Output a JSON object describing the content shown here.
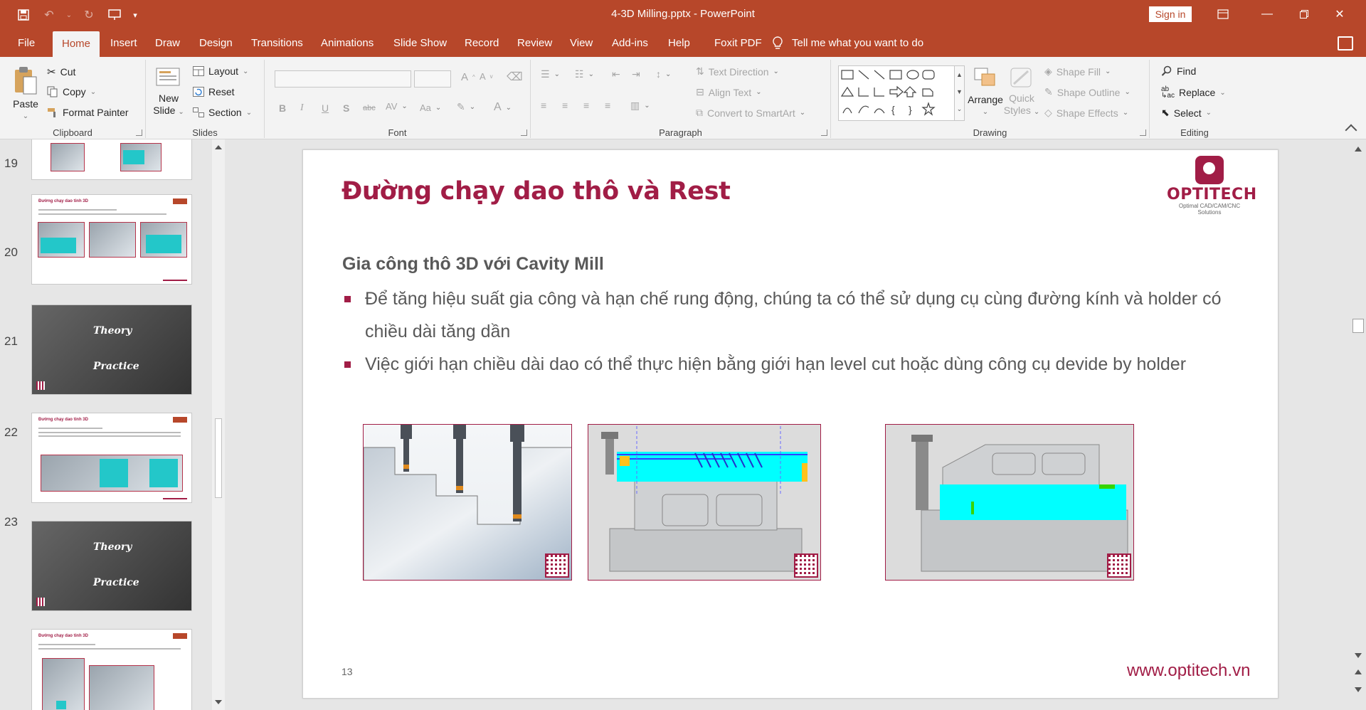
{
  "window": {
    "title": "4-3D Milling.pptx  -  PowerPoint",
    "sign_in": "Sign in"
  },
  "tabs": [
    "File",
    "Home",
    "Insert",
    "Draw",
    "Design",
    "Transitions",
    "Animations",
    "Slide Show",
    "Record",
    "Review",
    "View",
    "Add-ins",
    "Help",
    "Foxit PDF"
  ],
  "active_tab": "Home",
  "tell_me": "Tell me what you want to do",
  "ribbon": {
    "clipboard": {
      "label": "Clipboard",
      "paste": "Paste",
      "cut": "Cut",
      "copy": "Copy",
      "format_painter": "Format Painter"
    },
    "slides": {
      "label": "Slides",
      "new_slide_1": "New",
      "new_slide_2": "Slide",
      "layout": "Layout",
      "reset": "Reset",
      "section": "Section"
    },
    "font": {
      "label": "Font"
    },
    "paragraph": {
      "label": "Paragraph",
      "text_direction": "Text Direction",
      "align_text": "Align Text",
      "convert_smartart": "Convert to SmartArt"
    },
    "drawing": {
      "label": "Drawing",
      "arrange": "Arrange",
      "quick_styles_1": "Quick",
      "quick_styles_2": "Styles",
      "shape_fill": "Shape Fill",
      "shape_outline": "Shape Outline",
      "shape_effects": "Shape Effects"
    },
    "editing": {
      "label": "Editing",
      "find": "Find",
      "replace": "Replace",
      "select": "Select"
    }
  },
  "thumbnails": [
    {
      "num": "",
      "type": "light"
    },
    {
      "num": "19",
      "type": "light",
      "title": "Đường chạy dao tinh 3D"
    },
    {
      "num": "20",
      "type": "dark",
      "word1": "Theory",
      "word2": "Practice"
    },
    {
      "num": "21",
      "type": "light",
      "title": "Đường chạy dao tinh 3D"
    },
    {
      "num": "22",
      "type": "dark",
      "word1": "Theory",
      "word2": "Practice"
    },
    {
      "num": "23",
      "type": "light",
      "title": "Đường chạy dao tinh 3D"
    }
  ],
  "slide": {
    "title": "Đường chạy dao thô và Rest",
    "logo_text": "OPTITECH",
    "logo_tagline": "Optimal CAD/CAM/CNC Solutions",
    "subtitle": "Gia công thô 3D với Cavity Mill",
    "bullets": [
      "Để tăng hiệu suất gia công và hạn chế rung động, chúng ta có thể sử dụng cụ cùng đường kính và holder có chiều dài tăng dần",
      "Việc giới hạn chiều dài dao có thể thực hiện bằng giới hạn level cut hoặc dùng công cụ devide by holder"
    ],
    "slide_number": "13",
    "url": "www.optitech.vn"
  },
  "colors": {
    "accent": "#b7472a",
    "brand": "#a11d46",
    "toolpath_cyan": "#00ffff"
  }
}
